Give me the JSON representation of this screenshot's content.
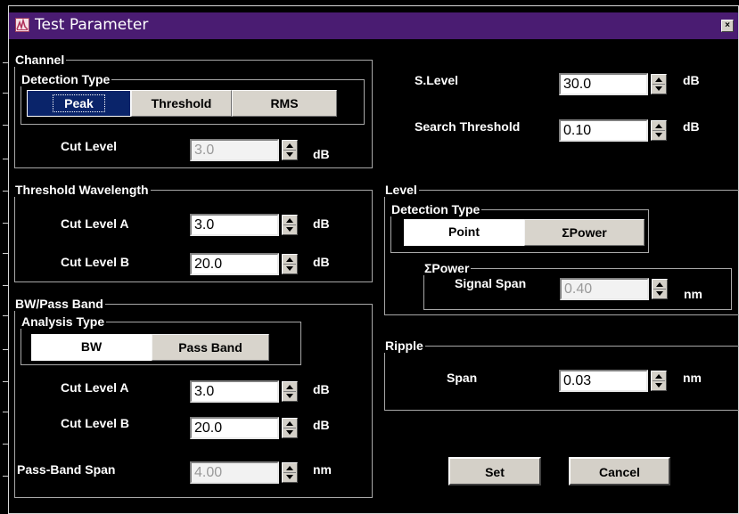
{
  "window": {
    "title": "Test Parameter",
    "close_glyph": "×"
  },
  "icons": {
    "app": "app-logo-icon",
    "close": "close-icon",
    "spin": "spin-up-down-icon"
  },
  "colors": {
    "titlebar": "#4a1c72",
    "selected": "#0a246a",
    "button_face": "#d4d0c8",
    "background": "#000000"
  },
  "channel": {
    "legend": "Channel",
    "detection_type": {
      "legend": "Detection Type",
      "options": [
        "Peak",
        "Threshold",
        "RMS"
      ],
      "selected": "Peak"
    },
    "cut_level": {
      "label": "Cut Level",
      "value": "3.0",
      "unit": "dB"
    }
  },
  "s_level": {
    "label": "S.Level",
    "value": "30.0",
    "unit": "dB"
  },
  "search_threshold": {
    "label": "Search Threshold",
    "value": "0.10",
    "unit": "dB"
  },
  "threshold_wavelength": {
    "legend": "Threshold Wavelength",
    "cut_level_a": {
      "label": "Cut Level A",
      "value": "3.0",
      "unit": "dB"
    },
    "cut_level_b": {
      "label": "Cut Level B",
      "value": "20.0",
      "unit": "dB"
    }
  },
  "level": {
    "legend": "Level",
    "detection_type": {
      "legend": "Detection Type",
      "options": [
        "Point",
        "ΣPower"
      ],
      "selected": "Point"
    },
    "sigma_power": {
      "legend": "ΣPower",
      "signal_span": {
        "label": "Signal Span",
        "value": "0.40",
        "unit": "nm"
      }
    }
  },
  "bw_pass_band": {
    "legend": "BW/Pass Band",
    "analysis_type": {
      "legend": "Analysis Type",
      "options": [
        "BW",
        "Pass Band"
      ],
      "selected": "BW"
    },
    "cut_level_a": {
      "label": "Cut Level A",
      "value": "3.0",
      "unit": "dB"
    },
    "cut_level_b": {
      "label": "Cut Level B",
      "value": "20.0",
      "unit": "dB"
    },
    "pass_band_span": {
      "label": "Pass-Band Span",
      "value": "4.00",
      "unit": "nm"
    }
  },
  "ripple": {
    "legend": "Ripple",
    "span": {
      "label": "Span",
      "value": "0.03",
      "unit": "nm"
    }
  },
  "buttons": {
    "set": "Set",
    "cancel": "Cancel"
  }
}
